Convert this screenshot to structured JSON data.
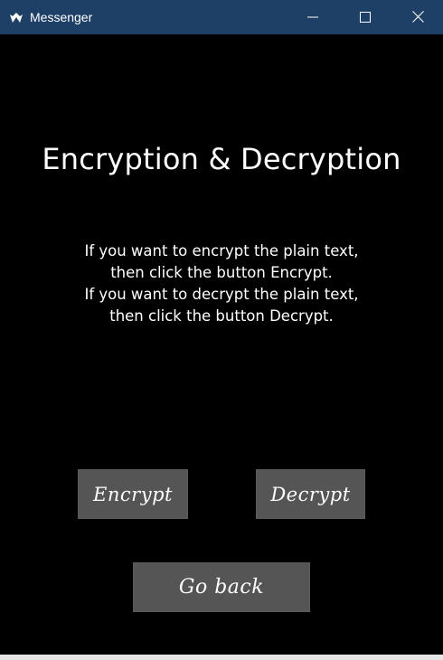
{
  "window": {
    "title": "Messenger",
    "titlebar_color": "#1e3f66",
    "background_color": "#000000",
    "controls": {
      "minimize_icon": "minimize-icon",
      "maximize_icon": "maximize-icon",
      "close_icon": "close-icon"
    }
  },
  "main": {
    "heading": "Encryption & Decryption",
    "instructions": [
      "If you want to encrypt the plain text,",
      "then click the button Encrypt.",
      "If you want to decrypt the plain text,",
      "then click the button Decrypt."
    ],
    "buttons": {
      "encrypt_label": "Encrypt",
      "decrypt_label": "Decrypt",
      "go_back_label": "Go back",
      "button_color": "#555555"
    }
  }
}
